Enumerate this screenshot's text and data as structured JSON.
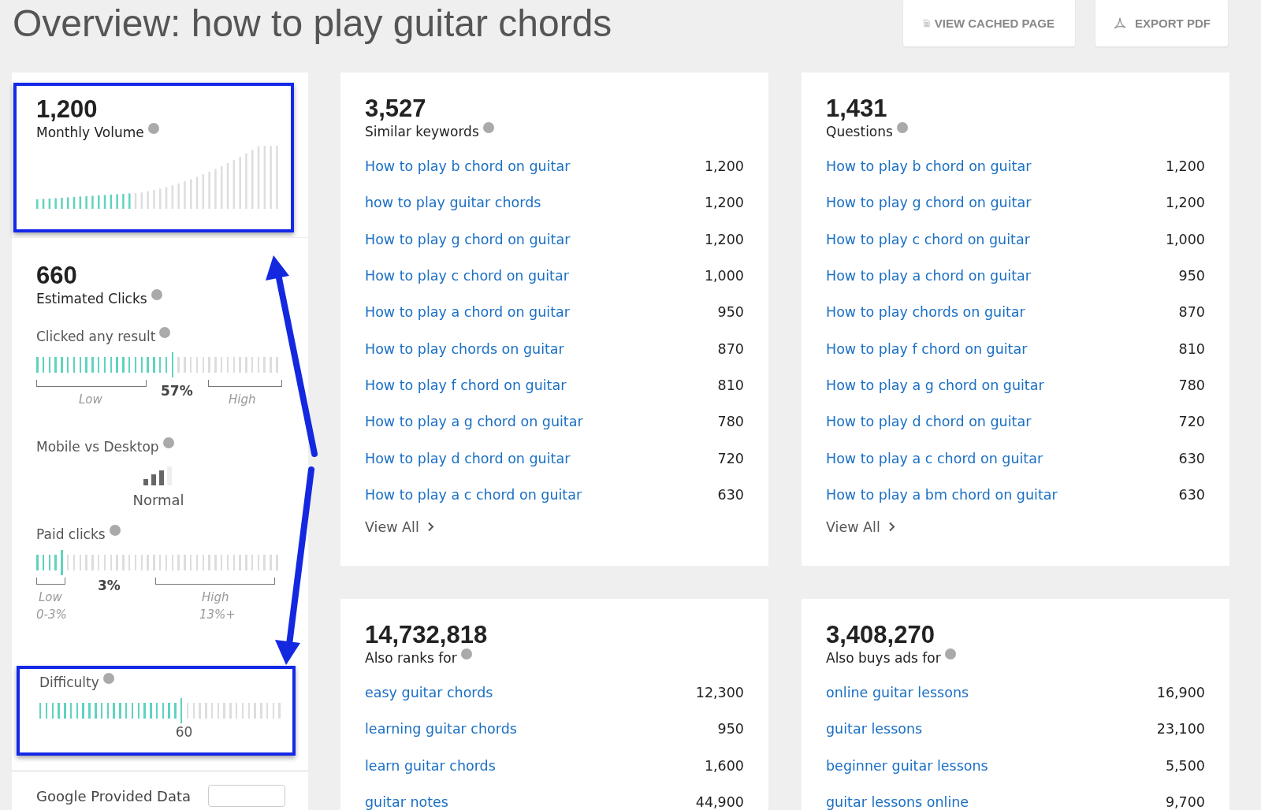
{
  "title": "Overview: how to play guitar chords",
  "header_buttons": [
    {
      "label": "VIEW CACHED PAGE",
      "kind": "cached"
    },
    {
      "label": "EXPORT PDF",
      "kind": "pdf"
    }
  ],
  "sidebar": {
    "monthly_volume": {
      "value": "1,200",
      "label": "Monthly Volume",
      "level": 0.4,
      "highlighted": true
    },
    "estimated_clicks": {
      "value": "660",
      "label": "Estimated Clicks"
    },
    "clicked_any_result": {
      "label": "Clicked any result",
      "level": 0.57,
      "reading": "57%",
      "low_label": "Low",
      "high_label": "High"
    },
    "mobile_vs_desktop": {
      "label": "Mobile vs Desktop",
      "reading": "Normal"
    },
    "paid_clicks": {
      "label": "Paid clicks",
      "level": 0.12,
      "reading": "3%",
      "low_label": "Low",
      "low_range": "0-3%",
      "high_label": "High",
      "high_range": "13%+"
    },
    "difficulty": {
      "label": "Difficulty",
      "level": 0.6,
      "reading": "60",
      "highlighted": true
    },
    "google_provided_data": {
      "label": "Google Provided Data"
    }
  },
  "cards": [
    {
      "count": "3,527",
      "label": "Similar keywords",
      "link": "View All",
      "rows": [
        {
          "keyword": "How to play b chord on guitar",
          "volume": "1,200"
        },
        {
          "keyword": "how to play guitar chords",
          "volume": "1,200"
        },
        {
          "keyword": "How to play g chord on guitar",
          "volume": "1,200"
        },
        {
          "keyword": "How to play c chord on guitar",
          "volume": "1,000"
        },
        {
          "keyword": "How to play a chord on guitar",
          "volume": "950"
        },
        {
          "keyword": "How to play chords on guitar",
          "volume": "870"
        },
        {
          "keyword": "How to play f chord on guitar",
          "volume": "810"
        },
        {
          "keyword": "How to play a g chord on guitar",
          "volume": "780"
        },
        {
          "keyword": "How to play d chord on guitar",
          "volume": "720"
        },
        {
          "keyword": "How to play a c chord on guitar",
          "volume": "630"
        }
      ]
    },
    {
      "count": "1,431",
      "label": "Questions",
      "link": "View All",
      "rows": [
        {
          "keyword": "How to play b chord on guitar",
          "volume": "1,200"
        },
        {
          "keyword": "How to play g chord on guitar",
          "volume": "1,200"
        },
        {
          "keyword": "How to play c chord on guitar",
          "volume": "1,000"
        },
        {
          "keyword": "How to play a chord on guitar",
          "volume": "950"
        },
        {
          "keyword": "How to play chords on guitar",
          "volume": "870"
        },
        {
          "keyword": "How to play f chord on guitar",
          "volume": "810"
        },
        {
          "keyword": "How to play a g chord on guitar",
          "volume": "780"
        },
        {
          "keyword": "How to play d chord on guitar",
          "volume": "720"
        },
        {
          "keyword": "How to play a c chord on guitar",
          "volume": "630"
        },
        {
          "keyword": "How to play a bm chord on guitar",
          "volume": "630"
        }
      ]
    },
    {
      "count": "14,732,818",
      "label": "Also ranks for",
      "rows": [
        {
          "keyword": "easy guitar chords",
          "volume": "12,300"
        },
        {
          "keyword": "learning guitar chords",
          "volume": "950"
        },
        {
          "keyword": "learn guitar chords",
          "volume": "1,600"
        },
        {
          "keyword": "guitar notes",
          "volume": "44,900"
        }
      ]
    },
    {
      "count": "3,408,270",
      "label": "Also buys ads for",
      "rows": [
        {
          "keyword": "online guitar lessons",
          "volume": "16,900"
        },
        {
          "keyword": "guitar lessons",
          "volume": "23,100"
        },
        {
          "keyword": "beginner guitar lessons",
          "volume": "5,500"
        },
        {
          "keyword": "guitar lessons online",
          "volume": "9,700"
        }
      ]
    }
  ]
}
